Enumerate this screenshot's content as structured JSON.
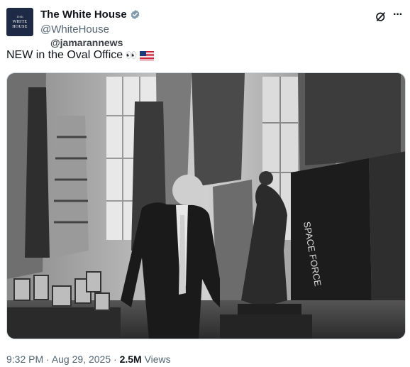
{
  "account": {
    "display_name": "The White House",
    "handle": "@WhiteHouse",
    "avatar_line1": "THE",
    "avatar_line2": "WHITE",
    "avatar_line3": "HOUSE",
    "verified_color": "#829aab"
  },
  "watermark": "@jamarannews",
  "tweet": {
    "text": "NEW in the Oval Office",
    "emoji_eyes": "👀",
    "emoji_flag": "us-flag"
  },
  "photo": {
    "banner_text": "SPACE FORCE"
  },
  "meta": {
    "time": "9:32 PM",
    "sep1": " · ",
    "date": "Aug 29, 2025",
    "sep2": " · ",
    "views_count": "2.5M",
    "views_label": " Views"
  },
  "icons": {
    "grok": "grok-icon",
    "more": "more-icon",
    "verified": "verified-badge-icon"
  }
}
